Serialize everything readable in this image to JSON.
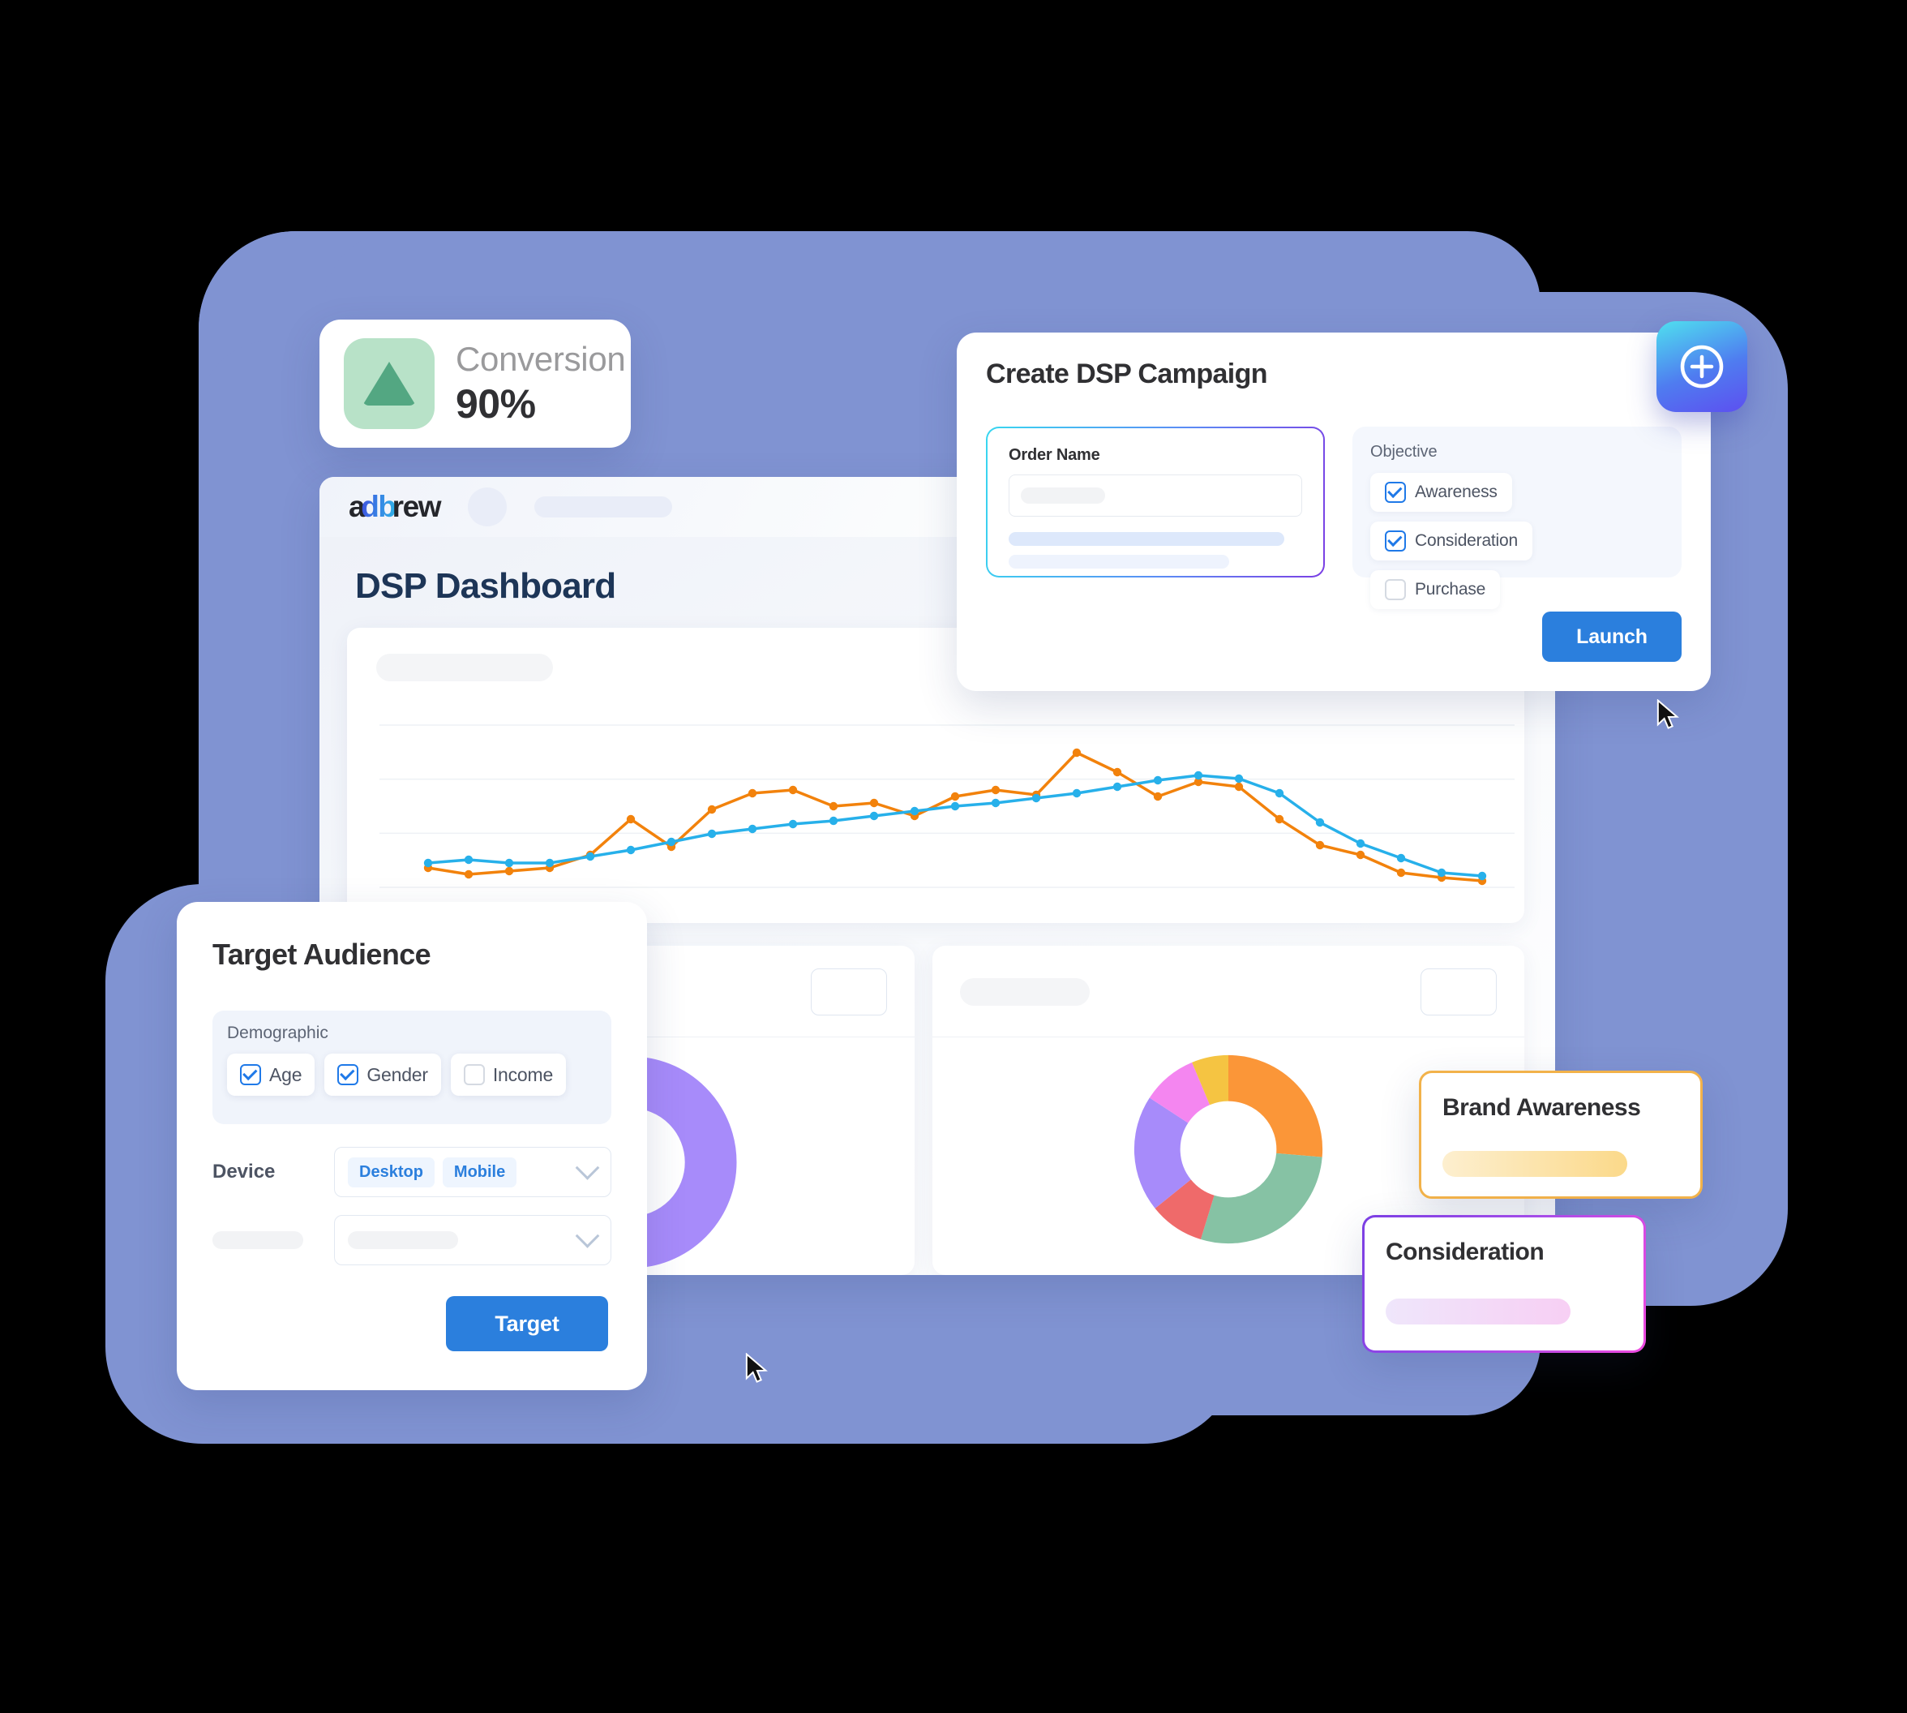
{
  "colors": {
    "backdrop": "#8093d2",
    "accent_blue": "#2b7fdd",
    "brand_awareness_border": "#f2b24a",
    "consideration_border": "#a44ce8",
    "chart_series_1": "#f2820c",
    "chart_series_2": "#27b0ea"
  },
  "conversion_card": {
    "icon": "triangle-up-icon",
    "label": "Conversion",
    "value": "90%"
  },
  "dashboard": {
    "logo": {
      "part1": "a",
      "part2": "db",
      "part3": "rew"
    },
    "avatar": "avatar-placeholder",
    "title": "DSP Dashboard",
    "lower_panels": [
      {
        "name": "donut-panel-left"
      },
      {
        "name": "donut-panel-right"
      }
    ]
  },
  "campaign": {
    "title": "Create DSP Campaign",
    "order_label": "Order Name",
    "order_value": "",
    "order_placeholder": "",
    "objective_label": "Objective",
    "objectives": [
      {
        "label": "Awareness",
        "checked": true
      },
      {
        "label": "Consideration",
        "checked": true
      },
      {
        "label": "Purchase",
        "checked": false
      }
    ],
    "launch_label": "Launch",
    "fab_icon": "plus-circle-icon"
  },
  "audience": {
    "title": "Target Audience",
    "demographic_label": "Demographic",
    "demographics": [
      {
        "label": "Age",
        "checked": true
      },
      {
        "label": "Gender",
        "checked": true
      },
      {
        "label": "Income",
        "checked": false
      }
    ],
    "device_label": "Device",
    "device_tags": [
      "Desktop",
      "Mobile"
    ],
    "target_label": "Target"
  },
  "objective_cards": [
    {
      "title": "Brand Awareness"
    },
    {
      "title": "Consideration"
    }
  ],
  "chart_data": [
    {
      "type": "line",
      "title": "",
      "xlabel": "",
      "ylabel": "",
      "grid": true,
      "legend": "none",
      "ylim": [
        0,
        100
      ],
      "x": [
        1,
        2,
        3,
        4,
        5,
        6,
        7,
        8,
        9,
        10,
        11,
        12,
        13,
        14,
        15,
        16,
        17,
        18,
        19,
        20,
        21,
        22,
        23,
        24,
        25,
        26,
        27
      ],
      "series": [
        {
          "name": "series-orange",
          "color": "#f2820c",
          "values": [
            12,
            8,
            10,
            12,
            20,
            42,
            25,
            48,
            58,
            60,
            50,
            52,
            44,
            56,
            60,
            57,
            83,
            71,
            56,
            65,
            62,
            42,
            26,
            20,
            9,
            6,
            4
          ]
        },
        {
          "name": "series-blue",
          "color": "#27b0ea",
          "values": [
            15,
            17,
            15,
            15,
            19,
            23,
            28,
            33,
            36,
            39,
            41,
            44,
            47,
            50,
            52,
            55,
            58,
            62,
            66,
            69,
            67,
            58,
            40,
            27,
            18,
            9,
            7
          ]
        }
      ]
    },
    {
      "type": "pie",
      "title": "",
      "name": "donut-left",
      "labels": [
        "segment-purple",
        "segment-yellow"
      ],
      "values": [
        50,
        50
      ],
      "colors": [
        "#a78bfa",
        "#f5c442"
      ]
    },
    {
      "type": "pie",
      "title": "",
      "name": "donut-right",
      "labels": [
        "segment-orange",
        "segment-green",
        "segment-red",
        "segment-purple",
        "segment-pink",
        "segment-yellow"
      ],
      "values": [
        25,
        27,
        9,
        19,
        9,
        6
      ],
      "colors": [
        "#fb9638",
        "#86c2a4",
        "#ef6a6a",
        "#a78bfa",
        "#f486f0",
        "#f5c442"
      ]
    }
  ]
}
